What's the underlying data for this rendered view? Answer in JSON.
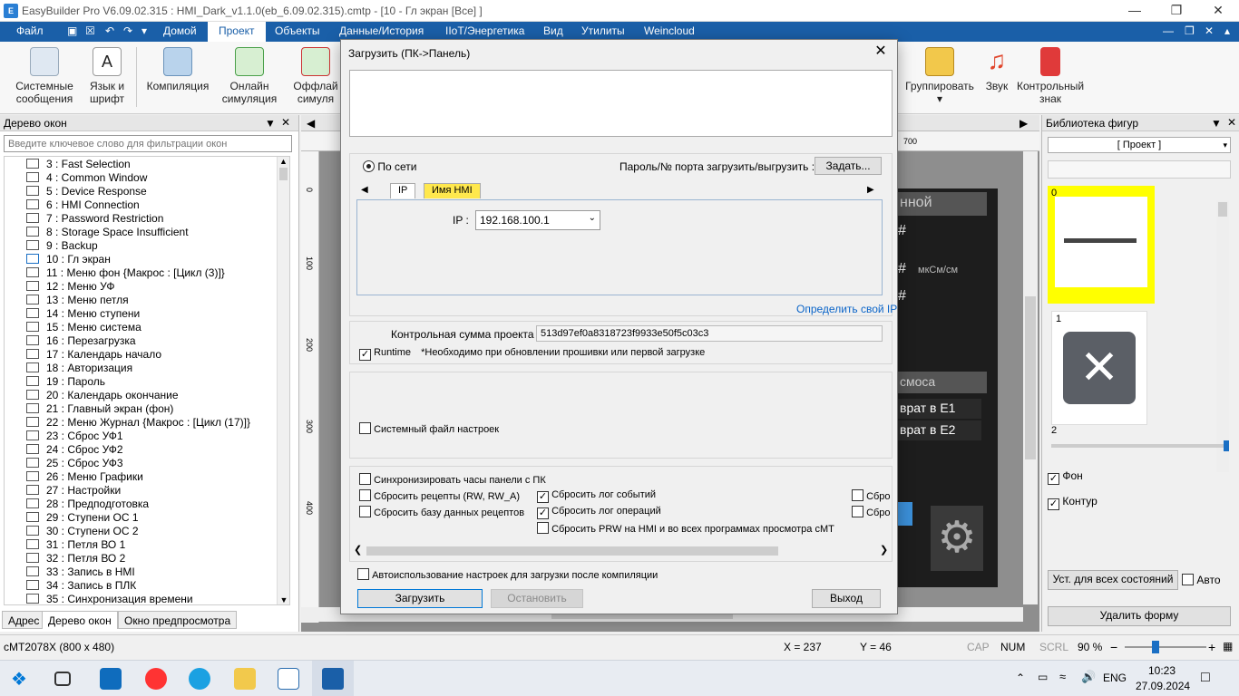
{
  "window": {
    "title": "EasyBuilder Pro V6.09.02.315 : HMI_Dark_v1.1.0(eb_6.09.02.315).cmtp - [10 - Гл экран [Все] ]"
  },
  "menu": {
    "file": "Файл",
    "home": "Домой",
    "project": "Проект",
    "objects": "Объекты",
    "data_history": "Данные/История",
    "iiot": "IIoT/Энергетика",
    "view": "Вид",
    "utilities": "Утилиты",
    "weincloud": "Weincloud"
  },
  "ribbon": {
    "system_messages": [
      "Системные",
      "сообщения"
    ],
    "language_font": [
      "Язык и",
      "шрифт"
    ],
    "compile": "Компиляция",
    "online_sim": [
      "Онлайн",
      "симуляция"
    ],
    "offline_sim": [
      "Оффлай",
      "симуля"
    ],
    "group": "Группировать",
    "sound": "Звук",
    "control_sign": [
      "Контрольный",
      "знак"
    ]
  },
  "left_panel": {
    "title": "Дерево окон",
    "filter_placeholder": "Введите ключевое слово для фильтрации окон",
    "items": [
      "3 : Fast Selection",
      "4 : Common Window",
      "5 : Device Response",
      "6 : HMI Connection",
      "7 : Password Restriction",
      "8 : Storage Space Insufficient",
      "9 : Backup",
      "10 : Гл экран",
      "11 : Меню фон {Макрос : [Цикл (3)]}",
      "12 : Меню УФ",
      "13 : Меню петля",
      "14 : Меню ступени",
      "15 : Меню система",
      "16 : Перезагрузка",
      "17 : Календарь начало",
      "18 : Авторизация",
      "19 : Пароль",
      "20 : Календарь окончание",
      "21 : Главный экран (фон)",
      "22 : Меню Журнал {Макрос : [Цикл (17)]}",
      "23 : Сброс УФ1",
      "24 : Сброс УФ2",
      "25 : Сброс УФ3",
      "26 : Меню Графики",
      "27 : Настройки",
      "28 : Предподготовка",
      "29 : Ступени ОС 1",
      "30 : Ступени ОС 2",
      "31 : Петля ВО 1",
      "32 : Петля ВО 2",
      "33 : Запись в HMI",
      "34 : Запись в ПЛК",
      "35 : Синхронизация времени"
    ],
    "tabs": [
      "Адрес",
      "Дерево окон",
      "Окно предпросмотра"
    ]
  },
  "right_panel": {
    "title": "Библиотека фигур",
    "dropdown": "[ Проект ]",
    "shape0": "0",
    "shape1": "1",
    "shape2": "2",
    "fill_label": "Фон",
    "outline_label": "Контур",
    "set_all_states": "Уст. для всех состояний",
    "auto_label": "Авто",
    "delete_shape": "Удалить форму"
  },
  "canvas": {
    "ruler_top": "700",
    "ruler_left": [
      "0",
      "100",
      "200",
      "300",
      "400"
    ],
    "hmi_text": [
      "нной",
      "мкСм/см",
      "смоса",
      "врат в E1",
      "врат в E2"
    ],
    "hash_mark": "#"
  },
  "dialog": {
    "title": "Загрузить (ПК->Панель)",
    "via_network": "По сети",
    "password_label": "Пароль/№ порта загрузить/выгрузить :",
    "set_button": "Задать...",
    "tab_ip": "IP",
    "tab_hmi_name": "Имя HMI",
    "ip_label": "IP :",
    "ip_value": "192.168.100.1",
    "detect_ip": "Определить свой IP",
    "checksum_label": "Контрольная сумма проекта :",
    "checksum_value": "513d97ef0a8318723f9933e50f5c03c3",
    "runtime_label": "Runtime",
    "runtime_note": "*Необходимо при обновлении прошивки или первой загрузке",
    "system_settings_file": "Системный файл настроек",
    "sync_clock": "Синхронизировать часы панели с ПК",
    "reset_recipes": "Сбросить рецепты (RW, RW_A)",
    "reset_event_log": "Сбросить лог событий",
    "reset_more_1": "Сбро",
    "reset_recipe_db": "Сбросить базу данных рецептов",
    "reset_operation_log": "Сбросить лог операций",
    "reset_more_2": "Сбро",
    "reset_prw": "Сбросить PRW на HMI и во всех программах просмотра cMT",
    "auto_use": "Автоиспользование настроек для загрузки после компиляции",
    "download_btn": "Загрузить",
    "stop_btn": "Остановить",
    "exit_btn": "Выход"
  },
  "statusbar": {
    "model": "cMT2078X (800 x 480)",
    "x": "X = 237",
    "y": "Y = 46",
    "cap": "CAP",
    "num": "NUM",
    "scrl": "SCRL",
    "zoom": "90 %"
  },
  "taskbar": {
    "language": "ENG",
    "time": "10:23",
    "date": "27.09.2024"
  },
  "colors": {
    "menubar": "#1a5fa8",
    "hmi_tab": "#ffe84d",
    "selected_shape": "#ffff00"
  }
}
